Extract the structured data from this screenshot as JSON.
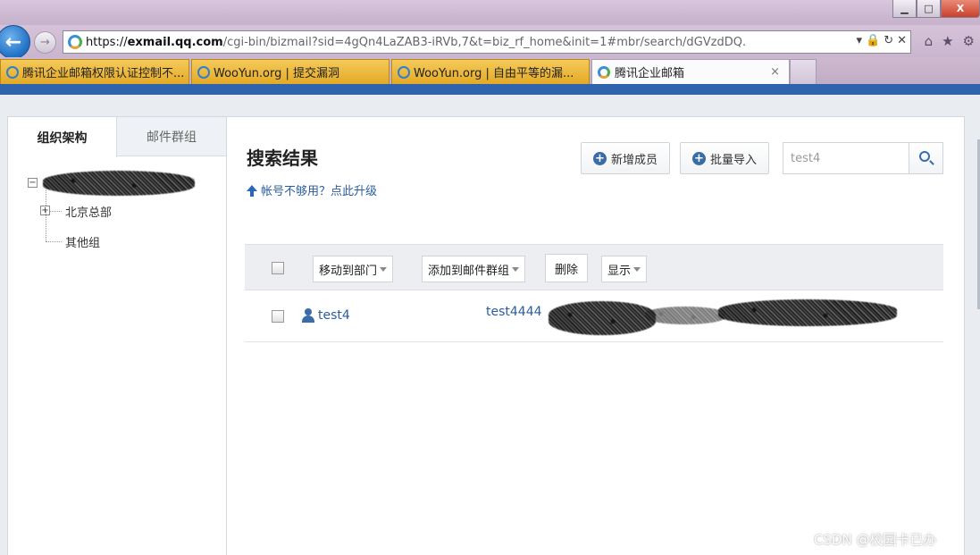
{
  "browser": {
    "window_buttons": {
      "minimize": "▁",
      "maximize": "□",
      "close": "X"
    },
    "back_icon": "←",
    "forward_icon": "→",
    "address": {
      "scheme": "https://",
      "domain": "exmail.qq.com",
      "path": "/cgi-bin/bizmail?sid=4gQn4LaZAB3-iRVb,7&t=biz_rf_home&init=1#mbr/search/dGVzdDQ.",
      "tools": [
        "▾",
        "🔒",
        "↻",
        "✕"
      ]
    },
    "nav_icons": [
      "⌂",
      "★",
      "⚙"
    ],
    "tabs": [
      {
        "label": "腾讯企业邮箱权限认证控制不...",
        "active": false
      },
      {
        "label": "WooYun.org | 提交漏洞",
        "active": false
      },
      {
        "label": "WooYun.org | 自由平等的漏...",
        "active": false
      },
      {
        "label": "腾讯企业邮箱",
        "active": true,
        "close": "×"
      }
    ]
  },
  "sidebar": {
    "tabs": [
      {
        "label": "组织架构",
        "active": true
      },
      {
        "label": "邮件群组",
        "active": false
      }
    ],
    "tree": {
      "root_toggle": "−",
      "children": [
        {
          "label": "北京总部",
          "toggle": "+"
        },
        {
          "label": "其他组"
        }
      ]
    }
  },
  "main": {
    "title": "搜索结果",
    "upgrade_link": "帐号不够用？点此升级",
    "add_member_label": "新增成员",
    "bulk_import_label": "批量导入",
    "search": {
      "value": "test4"
    },
    "toolbar": {
      "move_to_dept": "移动到部门",
      "add_to_group": "添加到邮件群组",
      "delete": "删除",
      "display": "显示"
    },
    "results": [
      {
        "name": "test4",
        "email": "test4444"
      }
    ]
  },
  "watermark": "CSDN @校园卡已办",
  "colors": {
    "accent_blue": "#2f64ad",
    "link_blue": "#2a5d9e",
    "tab_yellow": "#e4a926"
  }
}
